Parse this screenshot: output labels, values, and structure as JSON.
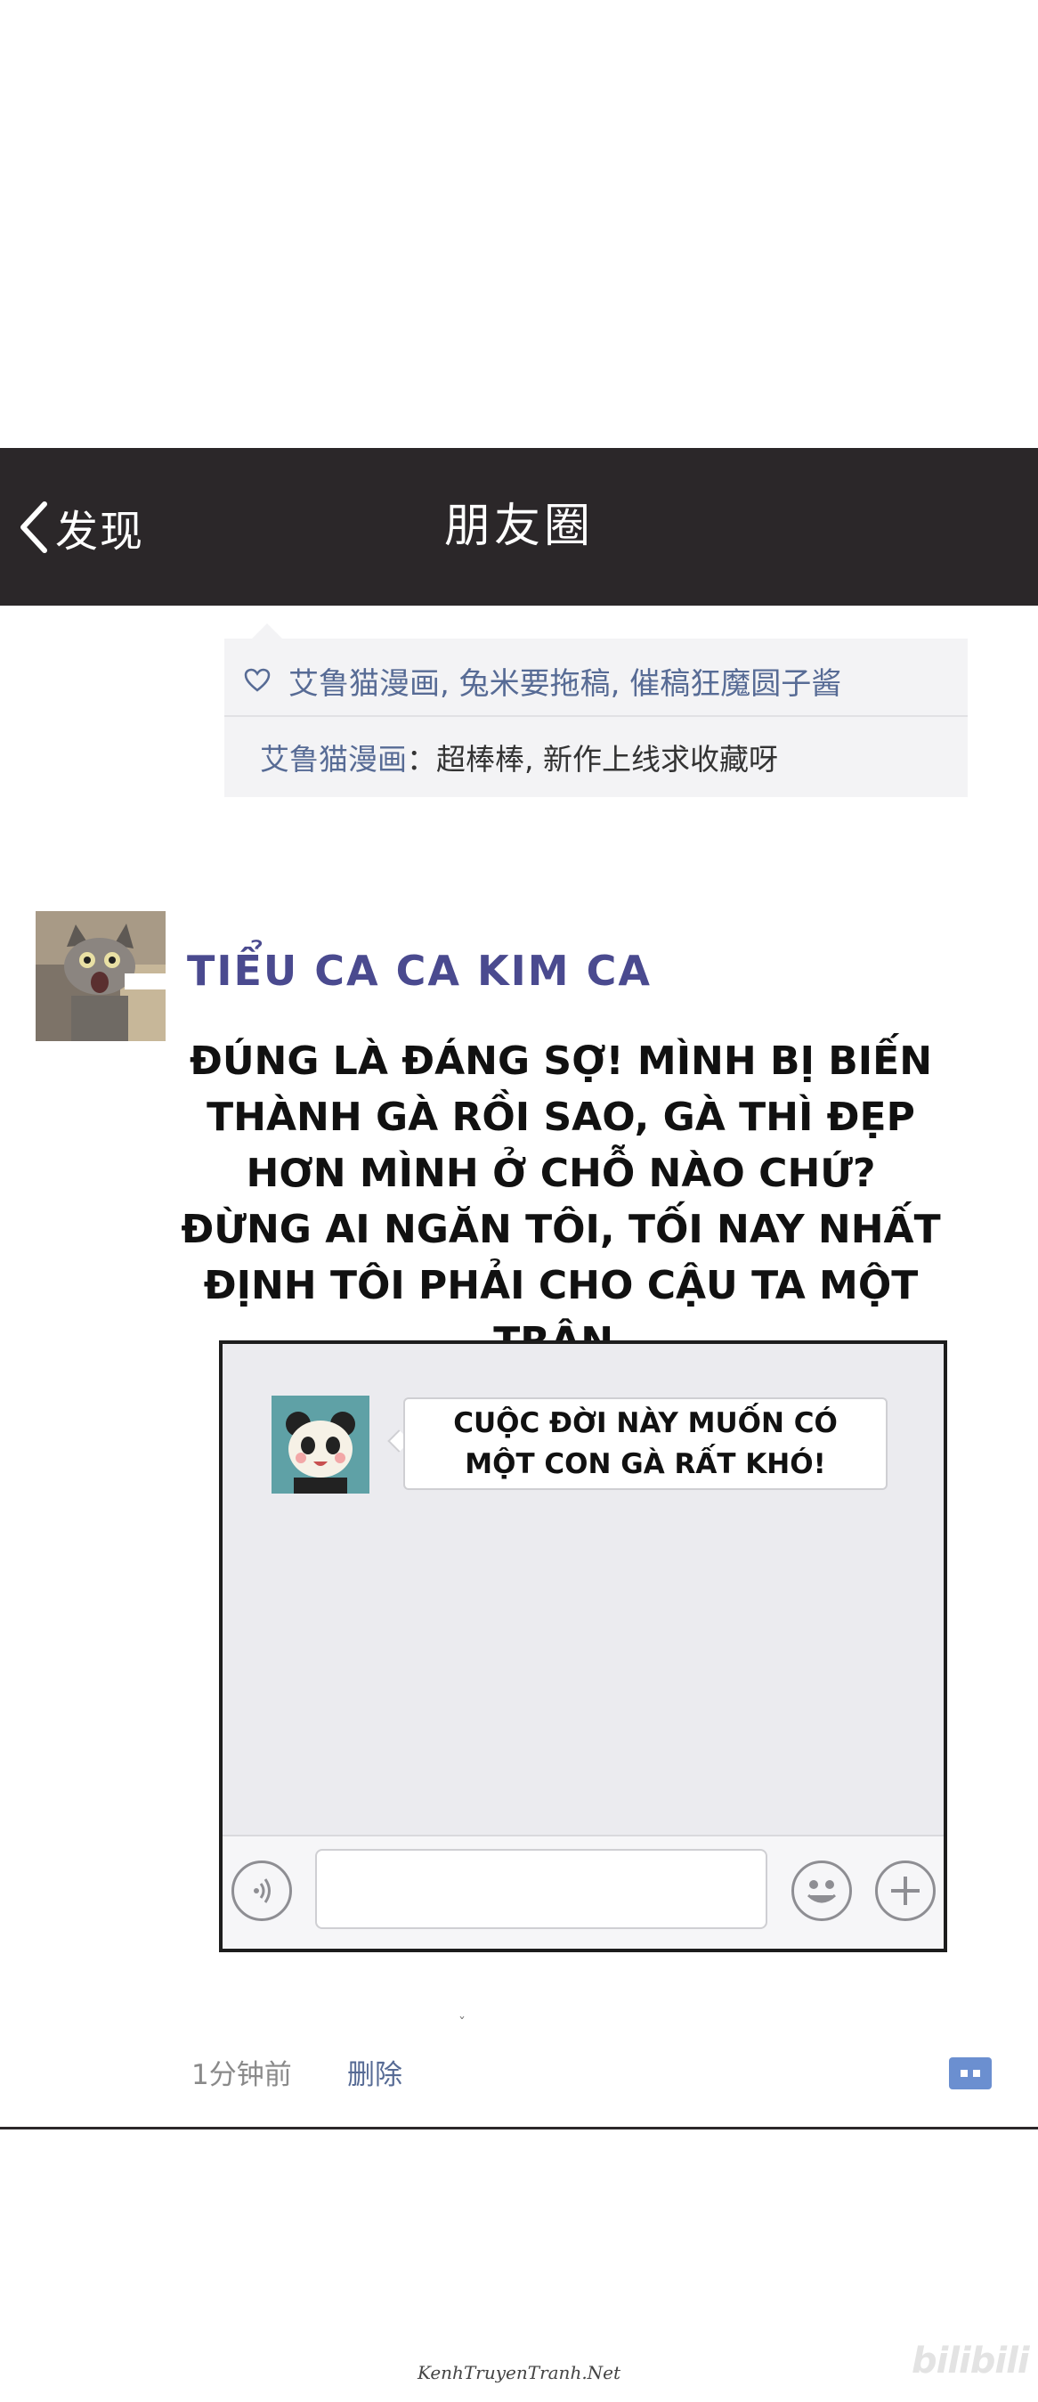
{
  "navbar": {
    "back_label": "发现",
    "title": "朋友圈"
  },
  "likes": {
    "names": "艾鲁猫漫画, 兔米要拖稿, 催稿狂魔圆子酱"
  },
  "comment": {
    "author": "艾鲁猫漫画",
    "colon": "：",
    "text": "超棒棒, 新作上线求收藏呀"
  },
  "post": {
    "name": "TIỂU CA CA KIM CA",
    "text": "ĐÚNG LÀ ĐÁNG SỢ! MÌNH BỊ BIẾN THÀNH GÀ RỒI SAO, GÀ THÌ ĐẸP HƠN MÌNH Ở CHỖ NÀO CHỨ? ĐỪNG AI NGĂN TÔI, TỐI NAY NHẤT ĐỊNH TÔI PHẢI CHO CẬU TA MỘT TRẬN."
  },
  "chat": {
    "message": "CUỘC ĐỜI NÀY MUỐN CÓ MỘT CON GÀ RẤT KHÓ!"
  },
  "meta": {
    "time": "1分钟前",
    "delete": "删除"
  },
  "mark": "ˇ",
  "credit": "KenhTruyenTranh.Net",
  "watermark": "bilibili",
  "colors": {
    "navbar": "#2b2729",
    "link": "#576b95",
    "name": "#4a4a8f",
    "more": "#6b8fd0"
  }
}
